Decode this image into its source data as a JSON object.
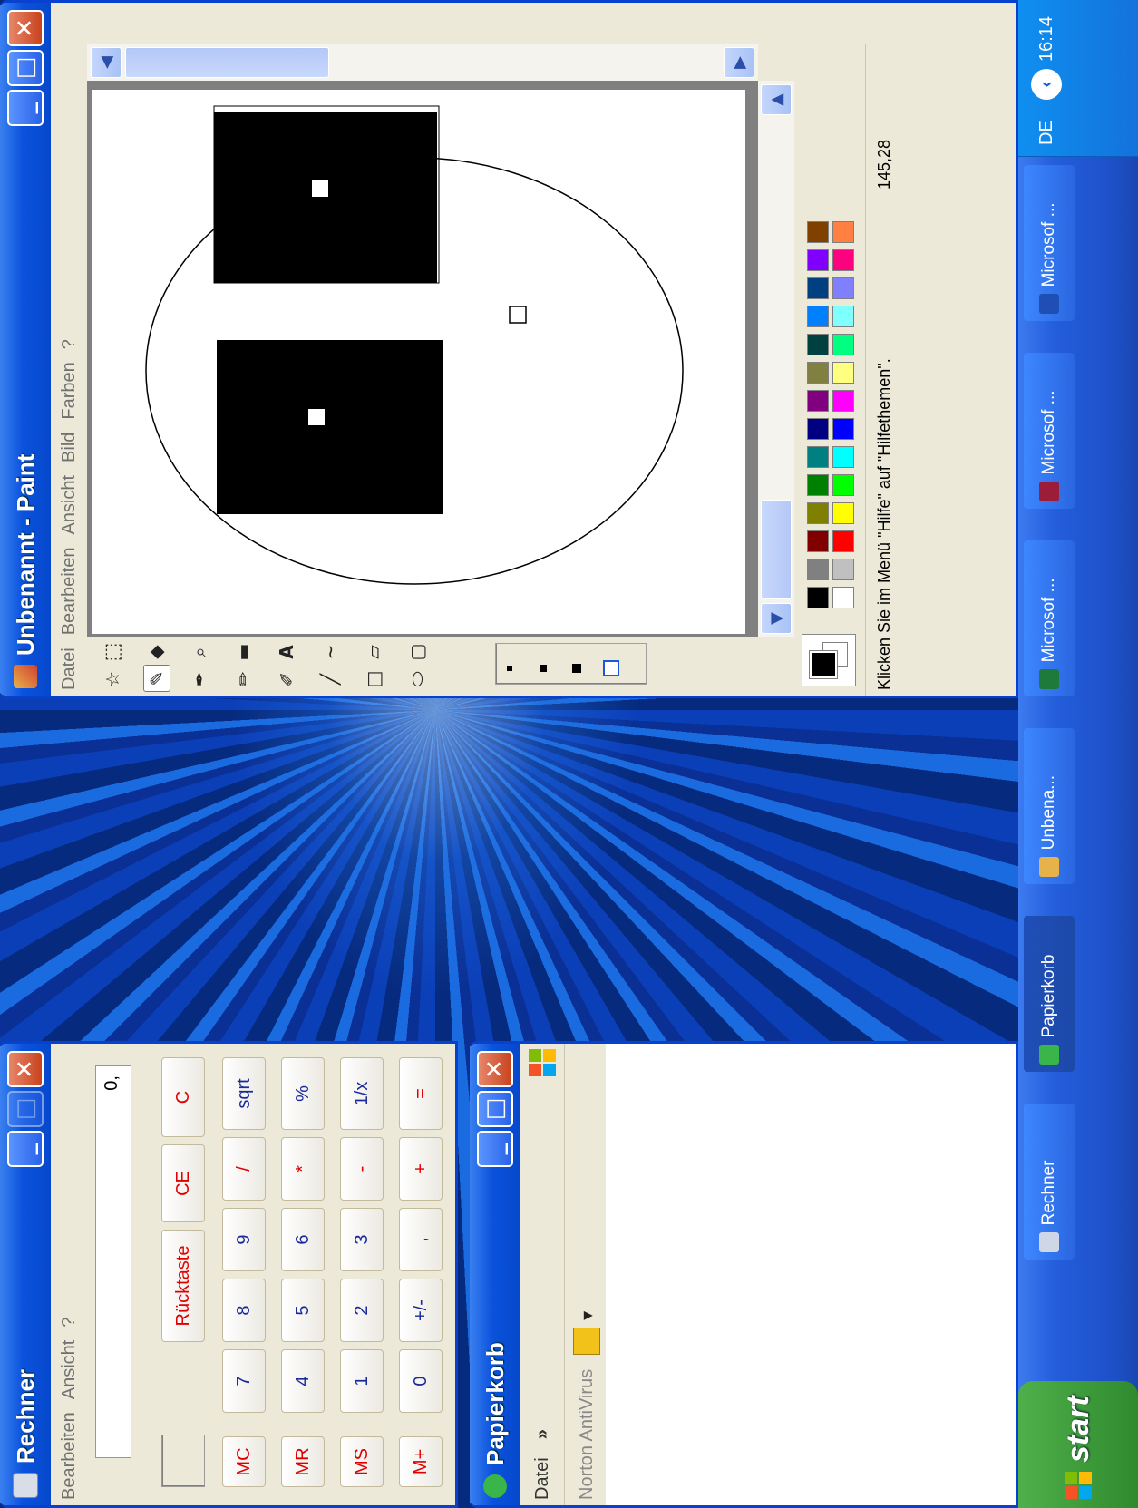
{
  "calculator": {
    "title": "Rechner",
    "menu": [
      "Bearbeiten",
      "Ansicht",
      "?"
    ],
    "display": "0,",
    "controls": {
      "backspace": "Rücktaste",
      "ce": "CE",
      "c": "C"
    },
    "memory": [
      "MC",
      "MR",
      "MS",
      "M+"
    ],
    "rows": [
      [
        "7",
        "8",
        "9",
        "/",
        "sqrt"
      ],
      [
        "4",
        "5",
        "6",
        "*",
        "%"
      ],
      [
        "1",
        "2",
        "3",
        "-",
        "1/x"
      ],
      [
        "0",
        "+/-",
        ",",
        "+",
        "="
      ]
    ]
  },
  "recycle_bin": {
    "title": "Papierkorb",
    "menu_file": "Datei",
    "chevron": "»",
    "toolbar_norton": "Norton AntiVirus",
    "dropdown_arrow": "▾"
  },
  "paint": {
    "title": "Unbenannt - Paint",
    "menu": [
      "Datei",
      "Bearbeiten",
      "Ansicht",
      "Bild",
      "Farben",
      "?"
    ],
    "status_message": "Klicken Sie im Menü \"Hilfe\" auf \"Hilfethemen\".",
    "coordinates": "145,28",
    "tools": [
      "free-select",
      "rect-select",
      "eraser",
      "fill",
      "color-picker",
      "magnifier",
      "pencil",
      "brush",
      "airbrush",
      "text",
      "line",
      "curve",
      "rectangle",
      "polygon",
      "ellipse",
      "rounded-rectangle"
    ],
    "selected_tool": "eraser",
    "palette_top": [
      "#000000",
      "#808080",
      "#800000",
      "#808000",
      "#008000",
      "#008080",
      "#000080",
      "#800080",
      "#808040",
      "#004040",
      "#0080ff",
      "#004080",
      "#8000ff",
      "#804000"
    ],
    "palette_bottom": [
      "#ffffff",
      "#c0c0c0",
      "#ff0000",
      "#ffff00",
      "#00ff00",
      "#00ffff",
      "#0000ff",
      "#ff00ff",
      "#ffff80",
      "#00ff80",
      "#80ffff",
      "#8080ff",
      "#ff0080",
      "#ff8040"
    ],
    "foreground": "#000000",
    "background": "#ffffff"
  },
  "taskbar": {
    "start": "start",
    "tasks": [
      {
        "label": "Rechner",
        "icon": "calculator-icon",
        "color": "#cfd6e6"
      },
      {
        "label": "Papierkorb",
        "icon": "recycle-bin-icon",
        "color": "#39b54a"
      },
      {
        "label": "Unbena...",
        "icon": "paint-icon",
        "color": "#e8b24a"
      },
      {
        "label": "Microsof ...",
        "icon": "excel-icon",
        "color": "#1d7a3a"
      },
      {
        "label": "Microsof ...",
        "icon": "access-icon",
        "color": "#9b1d3a"
      },
      {
        "label": "Microsof ...",
        "icon": "word-icon",
        "color": "#1f4fb4"
      }
    ],
    "language": "DE",
    "clock": "16:14"
  }
}
